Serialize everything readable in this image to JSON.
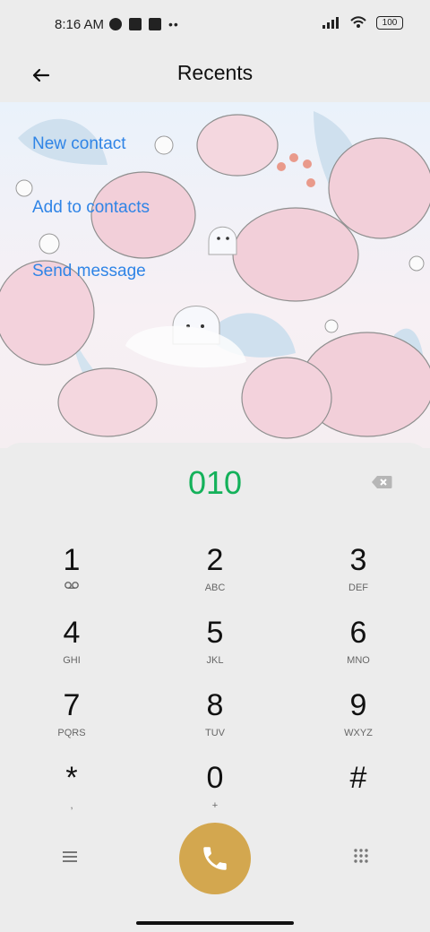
{
  "status": {
    "time": "8:16 AM",
    "battery": "100"
  },
  "header": {
    "title": "Recents"
  },
  "actions": [
    "New contact",
    "Add to contacts",
    "Send message"
  ],
  "dialer": {
    "number": "010",
    "keys": [
      {
        "digit": "1",
        "letters": ""
      },
      {
        "digit": "2",
        "letters": "ABC"
      },
      {
        "digit": "3",
        "letters": "DEF"
      },
      {
        "digit": "4",
        "letters": "GHI"
      },
      {
        "digit": "5",
        "letters": "JKL"
      },
      {
        "digit": "6",
        "letters": "MNO"
      },
      {
        "digit": "7",
        "letters": "PQRS"
      },
      {
        "digit": "8",
        "letters": "TUV"
      },
      {
        "digit": "9",
        "letters": "WXYZ"
      },
      {
        "digit": "*",
        "letters": ","
      },
      {
        "digit": "0",
        "letters": "+"
      },
      {
        "digit": "#",
        "letters": ""
      }
    ]
  },
  "colors": {
    "accent_blue": "#2f84e6",
    "number_green": "#14b15a",
    "call_gold": "#d3a74f"
  }
}
